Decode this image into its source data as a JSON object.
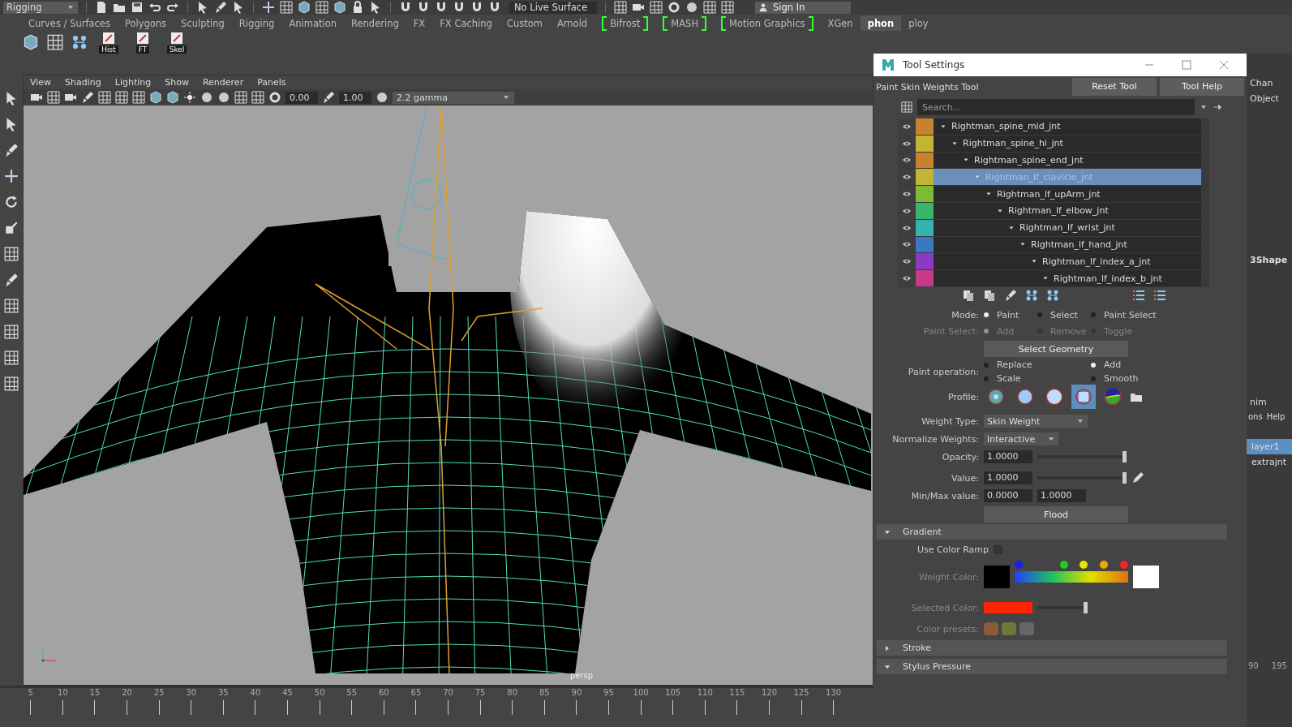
{
  "top_bar": {
    "mode_menu": "Rigging",
    "live_surface": "No Live Surface",
    "sign_in": "Sign In"
  },
  "shelf_tabs": [
    {
      "label": "Curves / Surfaces",
      "selected": false,
      "bracketed": false
    },
    {
      "label": "Polygons",
      "selected": false,
      "bracketed": false
    },
    {
      "label": "Sculpting",
      "selected": false,
      "bracketed": false
    },
    {
      "label": "Rigging",
      "selected": false,
      "bracketed": false
    },
    {
      "label": "Animation",
      "selected": false,
      "bracketed": false
    },
    {
      "label": "Rendering",
      "selected": false,
      "bracketed": false
    },
    {
      "label": "FX",
      "selected": false,
      "bracketed": false
    },
    {
      "label": "FX Caching",
      "selected": false,
      "bracketed": false
    },
    {
      "label": "Custom",
      "selected": false,
      "bracketed": false
    },
    {
      "label": "Arnold",
      "selected": false,
      "bracketed": false
    },
    {
      "label": "Bifrost",
      "selected": false,
      "bracketed": true
    },
    {
      "label": "MASH",
      "selected": false,
      "bracketed": true
    },
    {
      "label": "Motion Graphics",
      "selected": false,
      "bracketed": true
    },
    {
      "label": "XGen",
      "selected": false,
      "bracketed": false
    },
    {
      "label": "phon",
      "selected": true,
      "bracketed": false
    },
    {
      "label": "ploy",
      "selected": false,
      "bracketed": false
    }
  ],
  "shelf": {
    "buttons": [
      {
        "label": "Hist"
      },
      {
        "label": "FT"
      },
      {
        "label": "Skel"
      }
    ]
  },
  "viewport": {
    "menu": [
      "View",
      "Shading",
      "Lighting",
      "Show",
      "Renderer",
      "Panels"
    ],
    "exposure": "0.00",
    "gamma_value": "1.00",
    "color_space": "2.2 gamma",
    "camera": "persp"
  },
  "timeline": {
    "ticks": [
      "5",
      "10",
      "15",
      "20",
      "25",
      "30",
      "35",
      "40",
      "45",
      "50",
      "55",
      "60",
      "65",
      "70",
      "75",
      "80",
      "85",
      "90",
      "95",
      "100",
      "105",
      "110",
      "115",
      "120",
      "125",
      "130"
    ]
  },
  "tool_settings": {
    "title": "Tool Settings",
    "tool_name": "Paint Skin Weights Tool",
    "buttons": [
      "Reset Tool",
      "Tool Help"
    ],
    "search": {
      "placeholder": "Search..."
    },
    "influences": [
      {
        "label": "Rightman_spine_mid_jnt",
        "color": "#c8812f",
        "selected": false,
        "expanded": true,
        "children": [
          {
            "label": "Rightman_spine_hi_jnt",
            "color": "#c2b536",
            "selected": false,
            "expanded": true,
            "children": [
              {
                "label": "Rightman_spine_end_jnt",
                "color": "#c8812f",
                "selected": false,
                "expanded": true,
                "children": [
                  {
                    "label": "Rightman_lf_clavicle_jnt",
                    "color": "#c2b536",
                    "selected": true,
                    "expanded": true,
                    "children": [
                      {
                        "label": "Rightman_lf_upArm_jnt",
                        "color": "#7cba37",
                        "selected": false,
                        "expanded": true,
                        "children": [
                          {
                            "label": "Rightman_lf_elbow_jnt",
                            "color": "#3bb56a",
                            "selected": false,
                            "expanded": true,
                            "children": [
                              {
                                "label": "Rightman_lf_wrist_jnt",
                                "color": "#35b3b0",
                                "selected": false,
                                "expanded": true,
                                "children": [
                                  {
                                    "label": "Rightman_lf_hand_jnt",
                                    "color": "#3a78c4",
                                    "selected": false,
                                    "expanded": true,
                                    "children": [
                                      {
                                        "label": "Rightman_lf_index_a_jnt",
                                        "color": "#8a3ac4",
                                        "selected": false,
                                        "expanded": true,
                                        "children": [
                                          {
                                            "label": "Rightman_lf_index_b_jnt",
                                            "color": "#c43a86",
                                            "selected": false,
                                            "expanded": true
                                          }
                                        ]
                                      }
                                    ]
                                  }
                                ]
                              }
                            ]
                          }
                        ]
                      }
                    ]
                  }
                ]
              }
            ]
          }
        ]
      }
    ],
    "mode": {
      "label": "Mode:",
      "disabled": false,
      "options": [
        {
          "label": "Paint",
          "selected": true
        },
        {
          "label": "Select",
          "selected": false
        },
        {
          "label": "Paint Select",
          "selected": false
        }
      ]
    },
    "paint_select": {
      "label": "Paint Select:",
      "disabled": true,
      "options": [
        {
          "label": "Add",
          "selected": true
        },
        {
          "label": "Remove",
          "selected": false
        },
        {
          "label": "Toggle",
          "selected": false
        }
      ]
    },
    "select_geometry": "Select Geometry",
    "paint_operation": {
      "label": "Paint operation:",
      "options": [
        {
          "label": "Replace",
          "selected": false
        },
        {
          "label": "Add",
          "selected": true
        },
        {
          "label": "Scale",
          "selected": false
        },
        {
          "label": "Smooth",
          "selected": false
        }
      ]
    },
    "profile": {
      "label": "Profile:",
      "options": [
        {
          "selected": false
        },
        {
          "selected": false
        },
        {
          "selected": false
        },
        {
          "selected": true
        },
        {
          "selected": false
        }
      ]
    },
    "weight_type": {
      "label": "Weight Type:",
      "value": "Skin Weight"
    },
    "normalize": {
      "label": "Normalize Weights:",
      "value": "Interactive"
    },
    "opacity": {
      "label": "Opacity:",
      "value": "1.0000",
      "level": 1
    },
    "value": {
      "label": "Value:",
      "value": "1.0000",
      "level": 1
    },
    "min_max": {
      "label": "Min/Max value:",
      "min": "0.0000",
      "max": "1.0000"
    },
    "flood": "Flood",
    "gradient": {
      "title": "Gradient",
      "expanded": true,
      "use_color_ramp": {
        "label": "Use Color Ramp",
        "checked": false
      },
      "weight_color_label": "Weight Color:",
      "ramp_stops": [
        {
          "color": "#1a1aff"
        },
        {
          "color": "#22cc22"
        },
        {
          "color": "#e6e600"
        },
        {
          "color": "#f0a800"
        },
        {
          "color": "#ff2020"
        }
      ],
      "selected_color": {
        "label": "Selected Color:",
        "level": 1
      },
      "color_presets_label": "Color presets:"
    },
    "stroke": {
      "title": "Stroke",
      "expanded": false
    },
    "stylus": {
      "title": "Stylus Pressure",
      "expanded": true
    }
  },
  "channel_box": {
    "tab": "Chan",
    "header": "Object",
    "shape_name": "3Shape",
    "layer_tab": "nim",
    "menu": [
      "ons",
      "Help"
    ],
    "layers": [
      {
        "label": "layer1",
        "selected": true
      },
      {
        "label": "extrajnt",
        "selected": false
      }
    ],
    "time_ticks": [
      "90",
      "195"
    ]
  }
}
